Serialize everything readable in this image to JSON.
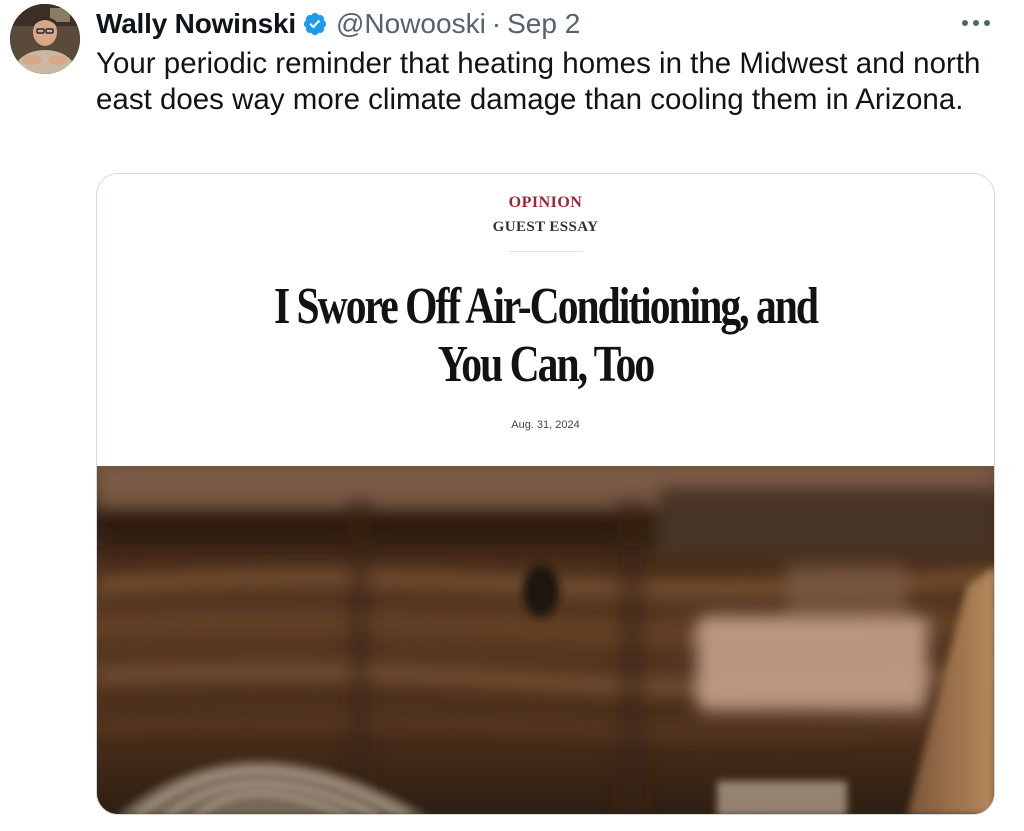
{
  "tweet": {
    "author_name": "Wally Nowinski",
    "handle": "@Nowooski",
    "separator": "·",
    "date": "Sep 2",
    "text": "Your periodic reminder that heating homes in the Midwest and north east does way more climate damage than cooling them in Arizona.",
    "verified_icon": "verified-badge-icon",
    "more_icon": "more-horizontal-icon"
  },
  "card": {
    "kicker": "OPINION",
    "subkicker": "GUEST ESSAY",
    "headline_line1": "I Swore Off Air-Conditioning, and",
    "headline_line2": "You Can, Too",
    "date": "Aug. 31, 2024",
    "image_icon": "blurry-room-fan-photo"
  },
  "colors": {
    "text": "#0f1419",
    "muted": "#536471",
    "verified": "#1d9bf0",
    "kicker": "#a02532",
    "border": "#cfd9de"
  }
}
